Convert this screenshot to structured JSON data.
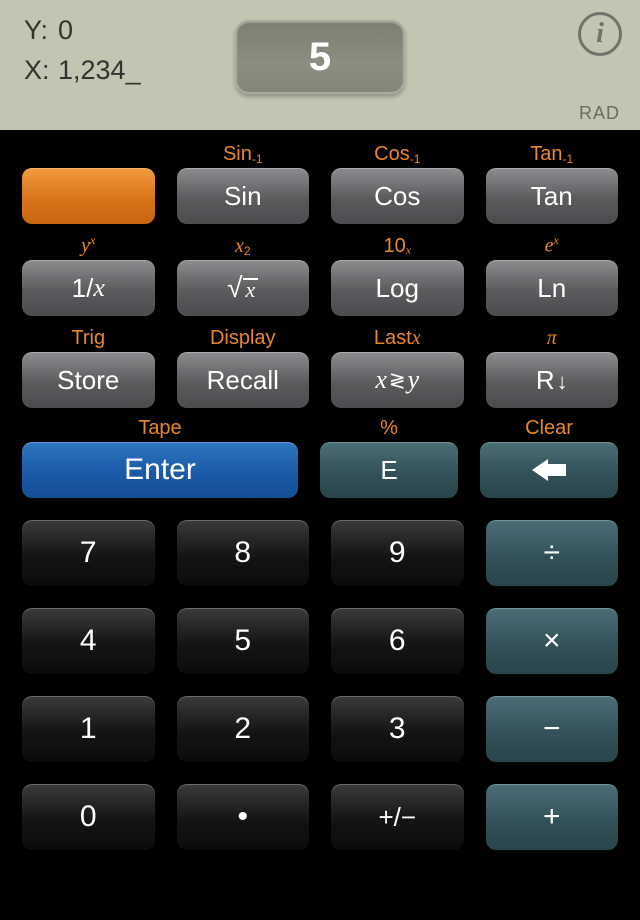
{
  "display": {
    "y_label": "Y:",
    "y_value": "0",
    "x_label": "X:",
    "x_value": "1,234_",
    "main": "5",
    "info_glyph": "i",
    "angle_mode": "RAD"
  },
  "alt": {
    "sin": "Sin⁻¹",
    "cos": "Cos⁻¹",
    "tan": "Tan⁻¹",
    "inv": "yˣ",
    "sqrt": "x²",
    "log": "10ˣ",
    "ln": "eˣ",
    "store": "Trig",
    "recall": "Display",
    "xswap": "Last x",
    "rdown": "π",
    "enter": "Tape",
    "e": "%",
    "back": "Clear"
  },
  "keys": {
    "shift": "",
    "sin": "Sin",
    "cos": "Cos",
    "tan": "Tan",
    "inv": "1/x",
    "sqrt": "√x",
    "log": "Log",
    "ln": "Ln",
    "store": "Store",
    "recall": "Recall",
    "xswap": "x ≷ y",
    "rdown": "R↓",
    "enter": "Enter",
    "e": "E",
    "back": "⬅",
    "d7": "7",
    "d8": "8",
    "d9": "9",
    "div": "÷",
    "d4": "4",
    "d5": "5",
    "d6": "6",
    "mul": "×",
    "d1": "1",
    "d2": "2",
    "d3": "3",
    "sub": "−",
    "d0": "0",
    "dot": "•",
    "neg": "+/−",
    "add": "+"
  }
}
